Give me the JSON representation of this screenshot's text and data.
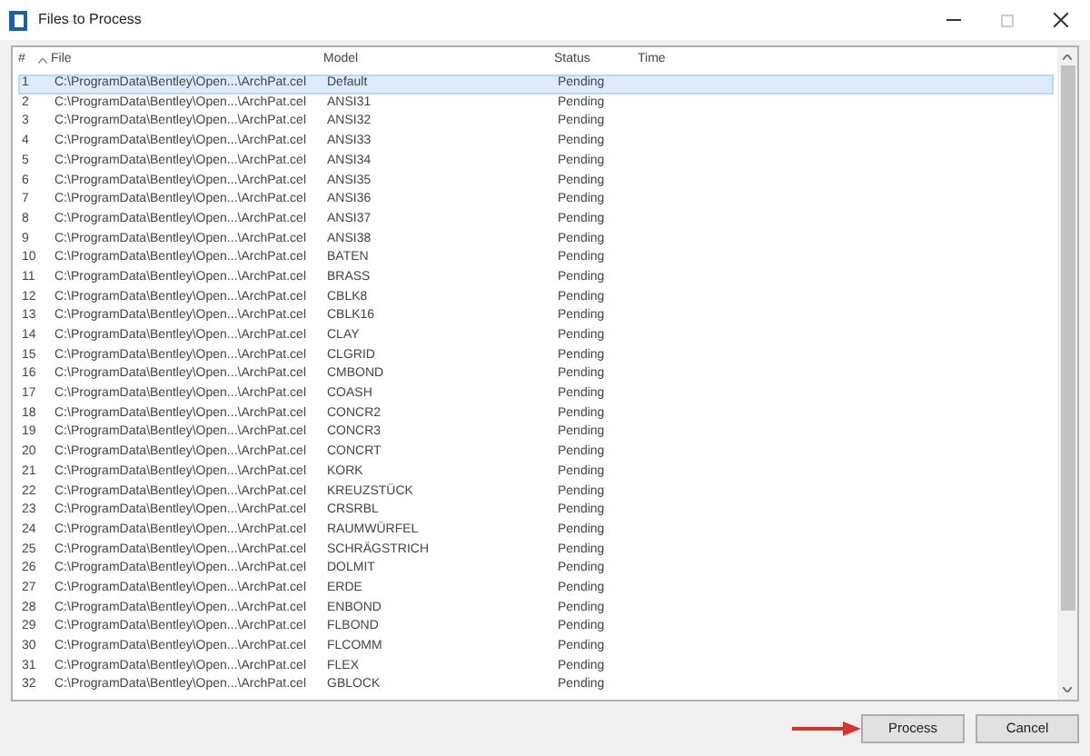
{
  "window": {
    "title": "Files to Process"
  },
  "table": {
    "columns": [
      {
        "label": "#",
        "sorted": false
      },
      {
        "label": "File",
        "sorted": true
      },
      {
        "label": "Model",
        "sorted": false
      },
      {
        "label": "Status",
        "sorted": false
      },
      {
        "label": "Time",
        "sorted": false
      }
    ],
    "rows": [
      {
        "cells": [
          "1",
          "C:\\ProgramData\\Bentley\\Open...\\ArchPat.cel",
          "Default",
          "Pending"
        ],
        "selected": true
      },
      {
        "cells": [
          "2",
          "C:\\ProgramData\\Bentley\\Open...\\ArchPat.cel",
          "ANSI31",
          "Pending"
        ],
        "selected": false
      },
      {
        "cells": [
          "3",
          "C:\\ProgramData\\Bentley\\Open...\\ArchPat.cel",
          "ANSI32",
          "Pending"
        ],
        "selected": false
      },
      {
        "cells": [
          "4",
          "C:\\ProgramData\\Bentley\\Open...\\ArchPat.cel",
          "ANSI33",
          "Pending"
        ],
        "selected": false
      },
      {
        "cells": [
          "5",
          "C:\\ProgramData\\Bentley\\Open...\\ArchPat.cel",
          "ANSI34",
          "Pending"
        ],
        "selected": false
      },
      {
        "cells": [
          "6",
          "C:\\ProgramData\\Bentley\\Open...\\ArchPat.cel",
          "ANSI35",
          "Pending"
        ],
        "selected": false
      },
      {
        "cells": [
          "7",
          "C:\\ProgramData\\Bentley\\Open...\\ArchPat.cel",
          "ANSI36",
          "Pending"
        ],
        "selected": false
      },
      {
        "cells": [
          "8",
          "C:\\ProgramData\\Bentley\\Open...\\ArchPat.cel",
          "ANSI37",
          "Pending"
        ],
        "selected": false
      },
      {
        "cells": [
          "9",
          "C:\\ProgramData\\Bentley\\Open...\\ArchPat.cel",
          "ANSI38",
          "Pending"
        ],
        "selected": false
      },
      {
        "cells": [
          "10",
          "C:\\ProgramData\\Bentley\\Open...\\ArchPat.cel",
          "BATEN",
          "Pending"
        ],
        "selected": false
      },
      {
        "cells": [
          "11",
          "C:\\ProgramData\\Bentley\\Open...\\ArchPat.cel",
          "BRASS",
          "Pending"
        ],
        "selected": false
      },
      {
        "cells": [
          "12",
          "C:\\ProgramData\\Bentley\\Open...\\ArchPat.cel",
          "CBLK8",
          "Pending"
        ],
        "selected": false
      },
      {
        "cells": [
          "13",
          "C:\\ProgramData\\Bentley\\Open...\\ArchPat.cel",
          "CBLK16",
          "Pending"
        ],
        "selected": false
      },
      {
        "cells": [
          "14",
          "C:\\ProgramData\\Bentley\\Open...\\ArchPat.cel",
          "CLAY",
          "Pending"
        ],
        "selected": false
      },
      {
        "cells": [
          "15",
          "C:\\ProgramData\\Bentley\\Open...\\ArchPat.cel",
          "CLGRID",
          "Pending"
        ],
        "selected": false
      },
      {
        "cells": [
          "16",
          "C:\\ProgramData\\Bentley\\Open...\\ArchPat.cel",
          "CMBOND",
          "Pending"
        ],
        "selected": false
      },
      {
        "cells": [
          "17",
          "C:\\ProgramData\\Bentley\\Open...\\ArchPat.cel",
          "COASH",
          "Pending"
        ],
        "selected": false
      },
      {
        "cells": [
          "18",
          "C:\\ProgramData\\Bentley\\Open...\\ArchPat.cel",
          "CONCR2",
          "Pending"
        ],
        "selected": false
      },
      {
        "cells": [
          "19",
          "C:\\ProgramData\\Bentley\\Open...\\ArchPat.cel",
          "CONCR3",
          "Pending"
        ],
        "selected": false
      },
      {
        "cells": [
          "20",
          "C:\\ProgramData\\Bentley\\Open...\\ArchPat.cel",
          "CONCRT",
          "Pending"
        ],
        "selected": false
      },
      {
        "cells": [
          "21",
          "C:\\ProgramData\\Bentley\\Open...\\ArchPat.cel",
          "KORK",
          "Pending"
        ],
        "selected": false
      },
      {
        "cells": [
          "22",
          "C:\\ProgramData\\Bentley\\Open...\\ArchPat.cel",
          "KREUZSTÜCK",
          "Pending"
        ],
        "selected": false
      },
      {
        "cells": [
          "23",
          "C:\\ProgramData\\Bentley\\Open...\\ArchPat.cel",
          "CRSRBL",
          "Pending"
        ],
        "selected": false
      },
      {
        "cells": [
          "24",
          "C:\\ProgramData\\Bentley\\Open...\\ArchPat.cel",
          "RAUMWÜRFEL",
          "Pending"
        ],
        "selected": false
      },
      {
        "cells": [
          "25",
          "C:\\ProgramData\\Bentley\\Open...\\ArchPat.cel",
          "SCHRÄGSTRICH",
          "Pending"
        ],
        "selected": false
      },
      {
        "cells": [
          "26",
          "C:\\ProgramData\\Bentley\\Open...\\ArchPat.cel",
          "DOLMIT",
          "Pending"
        ],
        "selected": false
      },
      {
        "cells": [
          "27",
          "C:\\ProgramData\\Bentley\\Open...\\ArchPat.cel",
          "ERDE",
          "Pending"
        ],
        "selected": false
      },
      {
        "cells": [
          "28",
          "C:\\ProgramData\\Bentley\\Open...\\ArchPat.cel",
          "ENBOND",
          "Pending"
        ],
        "selected": false
      },
      {
        "cells": [
          "29",
          "C:\\ProgramData\\Bentley\\Open...\\ArchPat.cel",
          "FLBOND",
          "Pending"
        ],
        "selected": false
      },
      {
        "cells": [
          "30",
          "C:\\ProgramData\\Bentley\\Open...\\ArchPat.cel",
          "FLCOMM",
          "Pending"
        ],
        "selected": false
      },
      {
        "cells": [
          "31",
          "C:\\ProgramData\\Bentley\\Open...\\ArchPat.cel",
          "FLEX",
          "Pending"
        ],
        "selected": false
      },
      {
        "cells": [
          "32",
          "C:\\ProgramData\\Bentley\\Open...\\ArchPat.cel",
          "GBLOCK",
          "Pending"
        ],
        "selected": false
      }
    ]
  },
  "buttons": [
    "Process",
    "Cancel"
  ]
}
